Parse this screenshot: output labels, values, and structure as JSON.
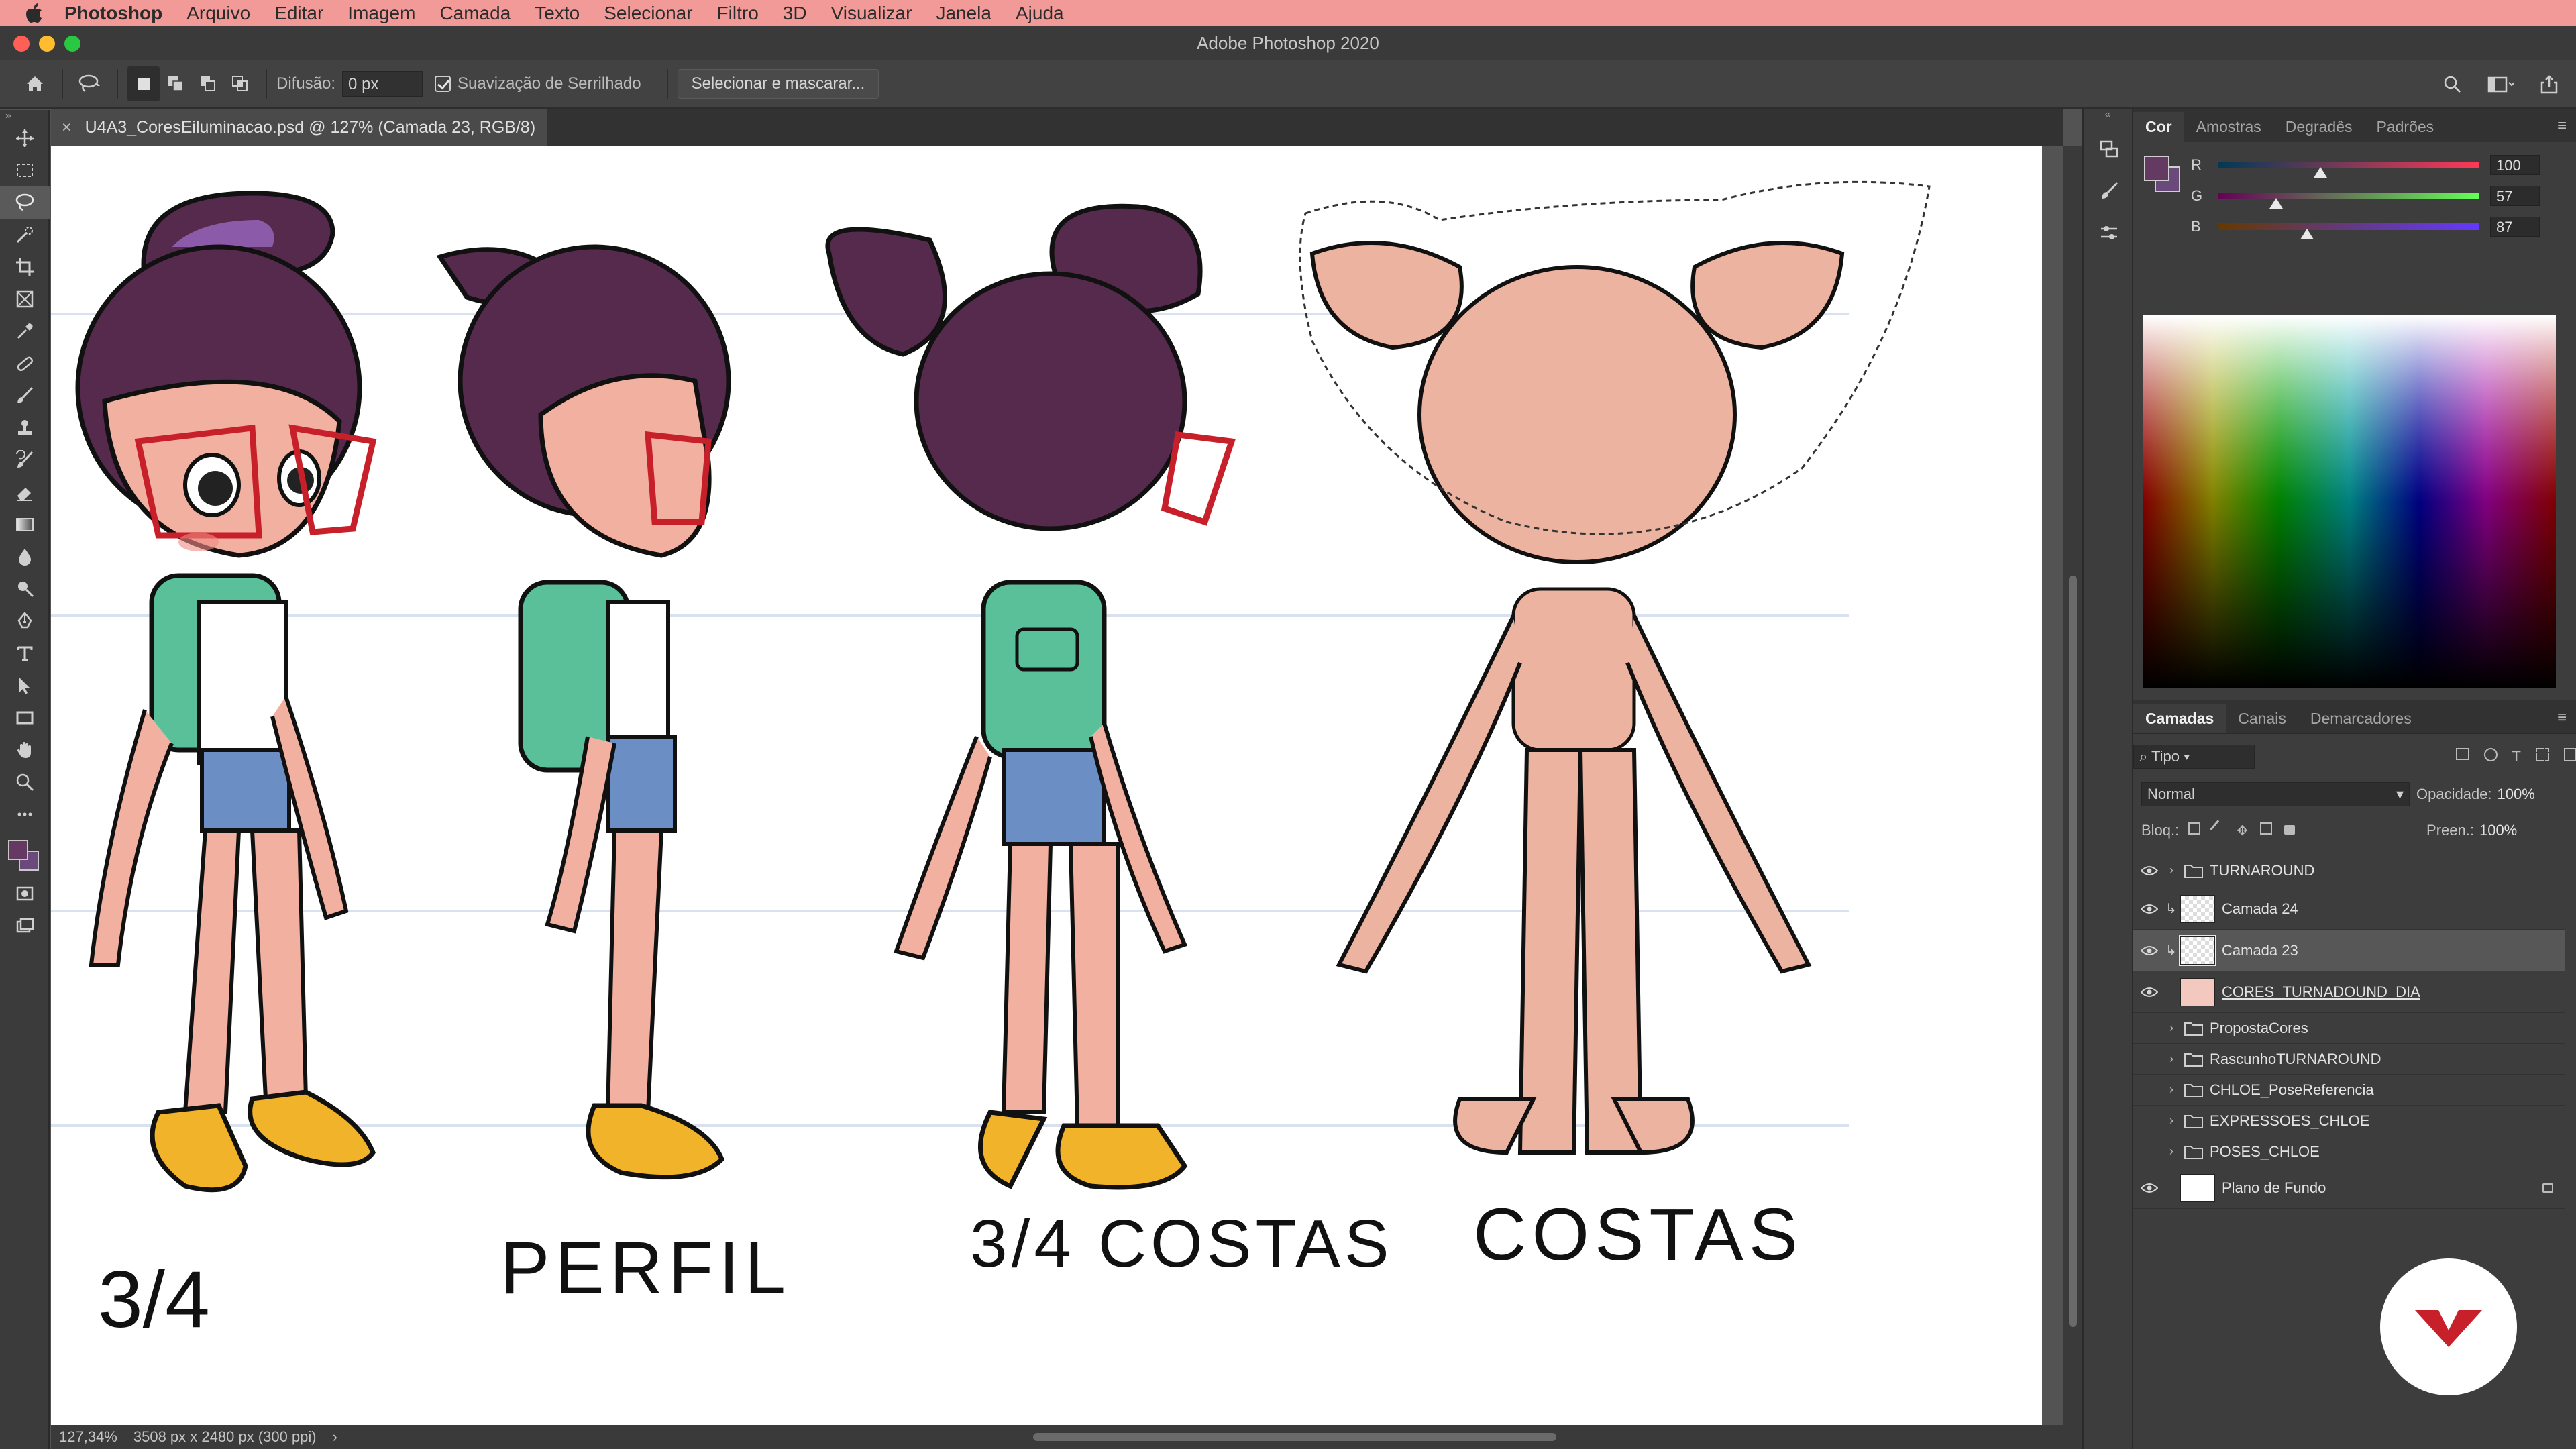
{
  "menubar": {
    "app": "Photoshop",
    "items": [
      "Arquivo",
      "Editar",
      "Imagem",
      "Camada",
      "Texto",
      "Selecionar",
      "Filtro",
      "3D",
      "Visualizar",
      "Janela",
      "Ajuda"
    ]
  },
  "window": {
    "title": "Adobe Photoshop 2020"
  },
  "options": {
    "feather_label": "Difusão:",
    "feather_value": "0 px",
    "antialias_label": "Suavização de Serrilhado",
    "select_mask_label": "Selecionar e mascarar..."
  },
  "document": {
    "tab_title": "U4A3_CoresEiluminacao.psd @ 127% (Camada 23, RGB/8)",
    "close_glyph": "×",
    "captions": [
      "3/4",
      "PERFIL",
      "3/4 COSTAS",
      "COSTAS"
    ]
  },
  "status": {
    "zoom": "127,34%",
    "doc_info": "3508 px x 2480 px (300 ppi)",
    "more": "›"
  },
  "color_panel": {
    "tabs": [
      "Cor",
      "Amostras",
      "Degradês",
      "Padrões"
    ],
    "fg_color": "#643962",
    "bg_color": "#6a4a7a",
    "r": {
      "label": "R",
      "value": "100",
      "fraction": 0.392
    },
    "g": {
      "label": "G",
      "value": "57",
      "fraction": 0.224
    },
    "b": {
      "label": "B",
      "value": "87",
      "fraction": 0.341
    }
  },
  "layers_panel": {
    "tabs": [
      "Camadas",
      "Canais",
      "Demarcadores"
    ],
    "filter_label": "Tipo",
    "blend_mode": "Normal",
    "opacity_label": "Opacidade:",
    "opacity_value": "100%",
    "lock_label": "Bloq.:",
    "fill_label": "Preen.:",
    "fill_value": "100%",
    "layers": [
      {
        "name": "TURNAROUND",
        "type": "group",
        "visible": true
      },
      {
        "name": "Camada 24",
        "type": "layer",
        "visible": true,
        "clipped": true
      },
      {
        "name": "Camada 23",
        "type": "layer",
        "visible": true,
        "clipped": true,
        "selected": true
      },
      {
        "name": "CORES_TURNADOUND_DIA",
        "type": "layer",
        "visible": true
      },
      {
        "name": "PropostaCores",
        "type": "group",
        "visible": false
      },
      {
        "name": "RascunhoTURNAROUND",
        "type": "group",
        "visible": false
      },
      {
        "name": "CHLOE_PoseReferencia",
        "type": "group",
        "visible": false
      },
      {
        "name": "EXPRESSOES_CHLOE",
        "type": "group",
        "visible": false
      },
      {
        "name": "POSES_CHLOE",
        "type": "group",
        "visible": false
      },
      {
        "name": "Plano de Fundo",
        "type": "background",
        "visible": true
      }
    ]
  },
  "colors": {
    "hair": "#552a4d",
    "hair_highlight": "#8b5aa8",
    "skin": "#f1b0a0",
    "backpack": "#5ac09a",
    "shorts": "#6b8fc4",
    "shoes": "#f0b32a",
    "glasses": "#c8202a",
    "brand": "#c8202a"
  }
}
